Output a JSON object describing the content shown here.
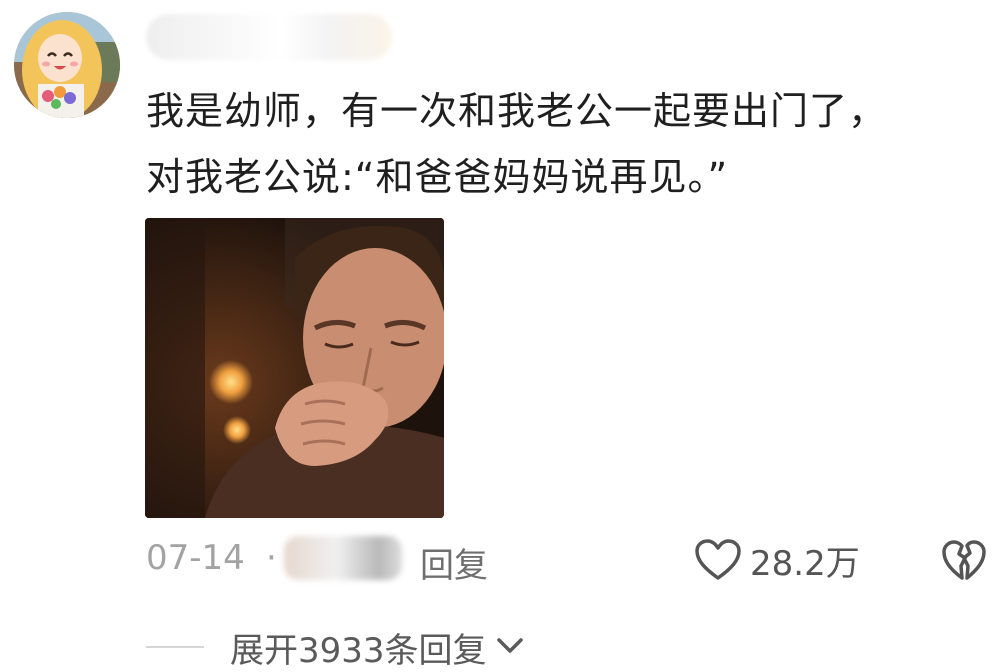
{
  "comment": {
    "text_line1": "我是幼师，有一次和我老公一起要出门了，",
    "text_line2": "对我老公说:“和爸爸妈妈说再见。”",
    "date": "07-14",
    "separator": "·",
    "reply_label": "回复",
    "like_count": "28.2万",
    "expand_replies_label": "展开3933条回复"
  },
  "icons": {
    "like": "heart-outline-icon",
    "dislike": "broken-heart-icon",
    "expand": "chevron-down-icon"
  },
  "colors": {
    "meta_text": "#a3a3a3",
    "reply_text": "#6f6f6f",
    "body_text": "#1f1f1f"
  }
}
